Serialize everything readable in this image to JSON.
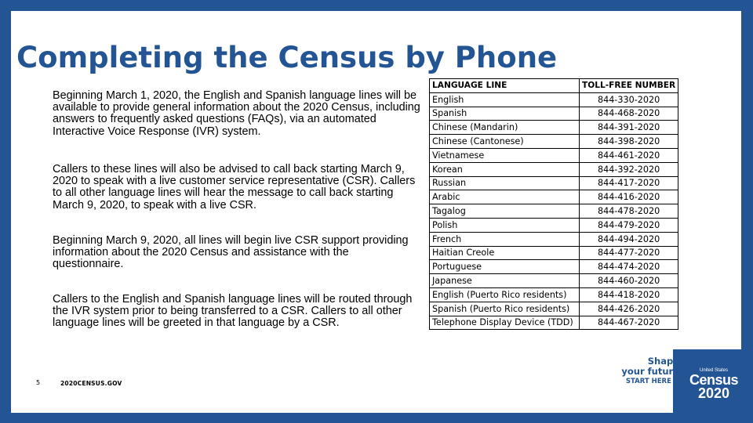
{
  "slide": {
    "title": "Completing the Census by Phone",
    "paragraphs": [
      "Beginning March 1, 2020, the English and Spanish language lines will be available to provide general information about the 2020 Census, including answers to frequently asked questions (FAQs), via an automated Interactive Voice Response (IVR) system.",
      "Callers to these lines will also be advised to call back starting March 9, 2020 to speak with a live customer service representative (CSR). Callers to all other language lines will hear the message to call back starting March 9, 2020, to speak with a live CSR.",
      "Beginning March 9, 2020, all lines will begin live CSR support providing information about the 2020 Census and assistance with the questionnaire.",
      "Callers to the English and Spanish language lines will be routed through the IVR system prior to being transferred to a CSR. Callers to all other language lines will be greeted in that language by a CSR."
    ],
    "page_number": "5",
    "footer_site": "2020CENSUS.GOV"
  },
  "table": {
    "headers": [
      "LANGUAGE LINE",
      "TOLL-FREE NUMBER"
    ],
    "rows": [
      [
        "English",
        "844-330-2020"
      ],
      [
        "Spanish",
        "844-468-2020"
      ],
      [
        "Chinese (Mandarin)",
        "844-391-2020"
      ],
      [
        "Chinese (Cantonese)",
        "844-398-2020"
      ],
      [
        "Vietnamese",
        "844-461-2020"
      ],
      [
        "Korean",
        "844-392-2020"
      ],
      [
        "Russian",
        "844-417-2020"
      ],
      [
        "Arabic",
        "844-416-2020"
      ],
      [
        "Tagalog",
        "844-478-2020"
      ],
      [
        "Polish",
        "844-479-2020"
      ],
      [
        "French",
        "844-494-2020"
      ],
      [
        "Haitian Creole",
        "844-477-2020"
      ],
      [
        "Portuguese",
        "844-474-2020"
      ],
      [
        "Japanese",
        "844-460-2020"
      ],
      [
        "English (Puerto Rico residents)",
        "844-418-2020"
      ],
      [
        "Spanish (Puerto Rico residents)",
        "844-426-2020"
      ],
      [
        "Telephone Display Device (TDD)",
        "844-467-2020"
      ]
    ]
  },
  "branding": {
    "tagline_line1": "Shape",
    "tagline_line2": "your future",
    "cta": "START HERE >",
    "logo_small": "United States",
    "logo_main": "Census",
    "logo_year": "2020"
  },
  "colors": {
    "brand_blue": "#235594"
  }
}
